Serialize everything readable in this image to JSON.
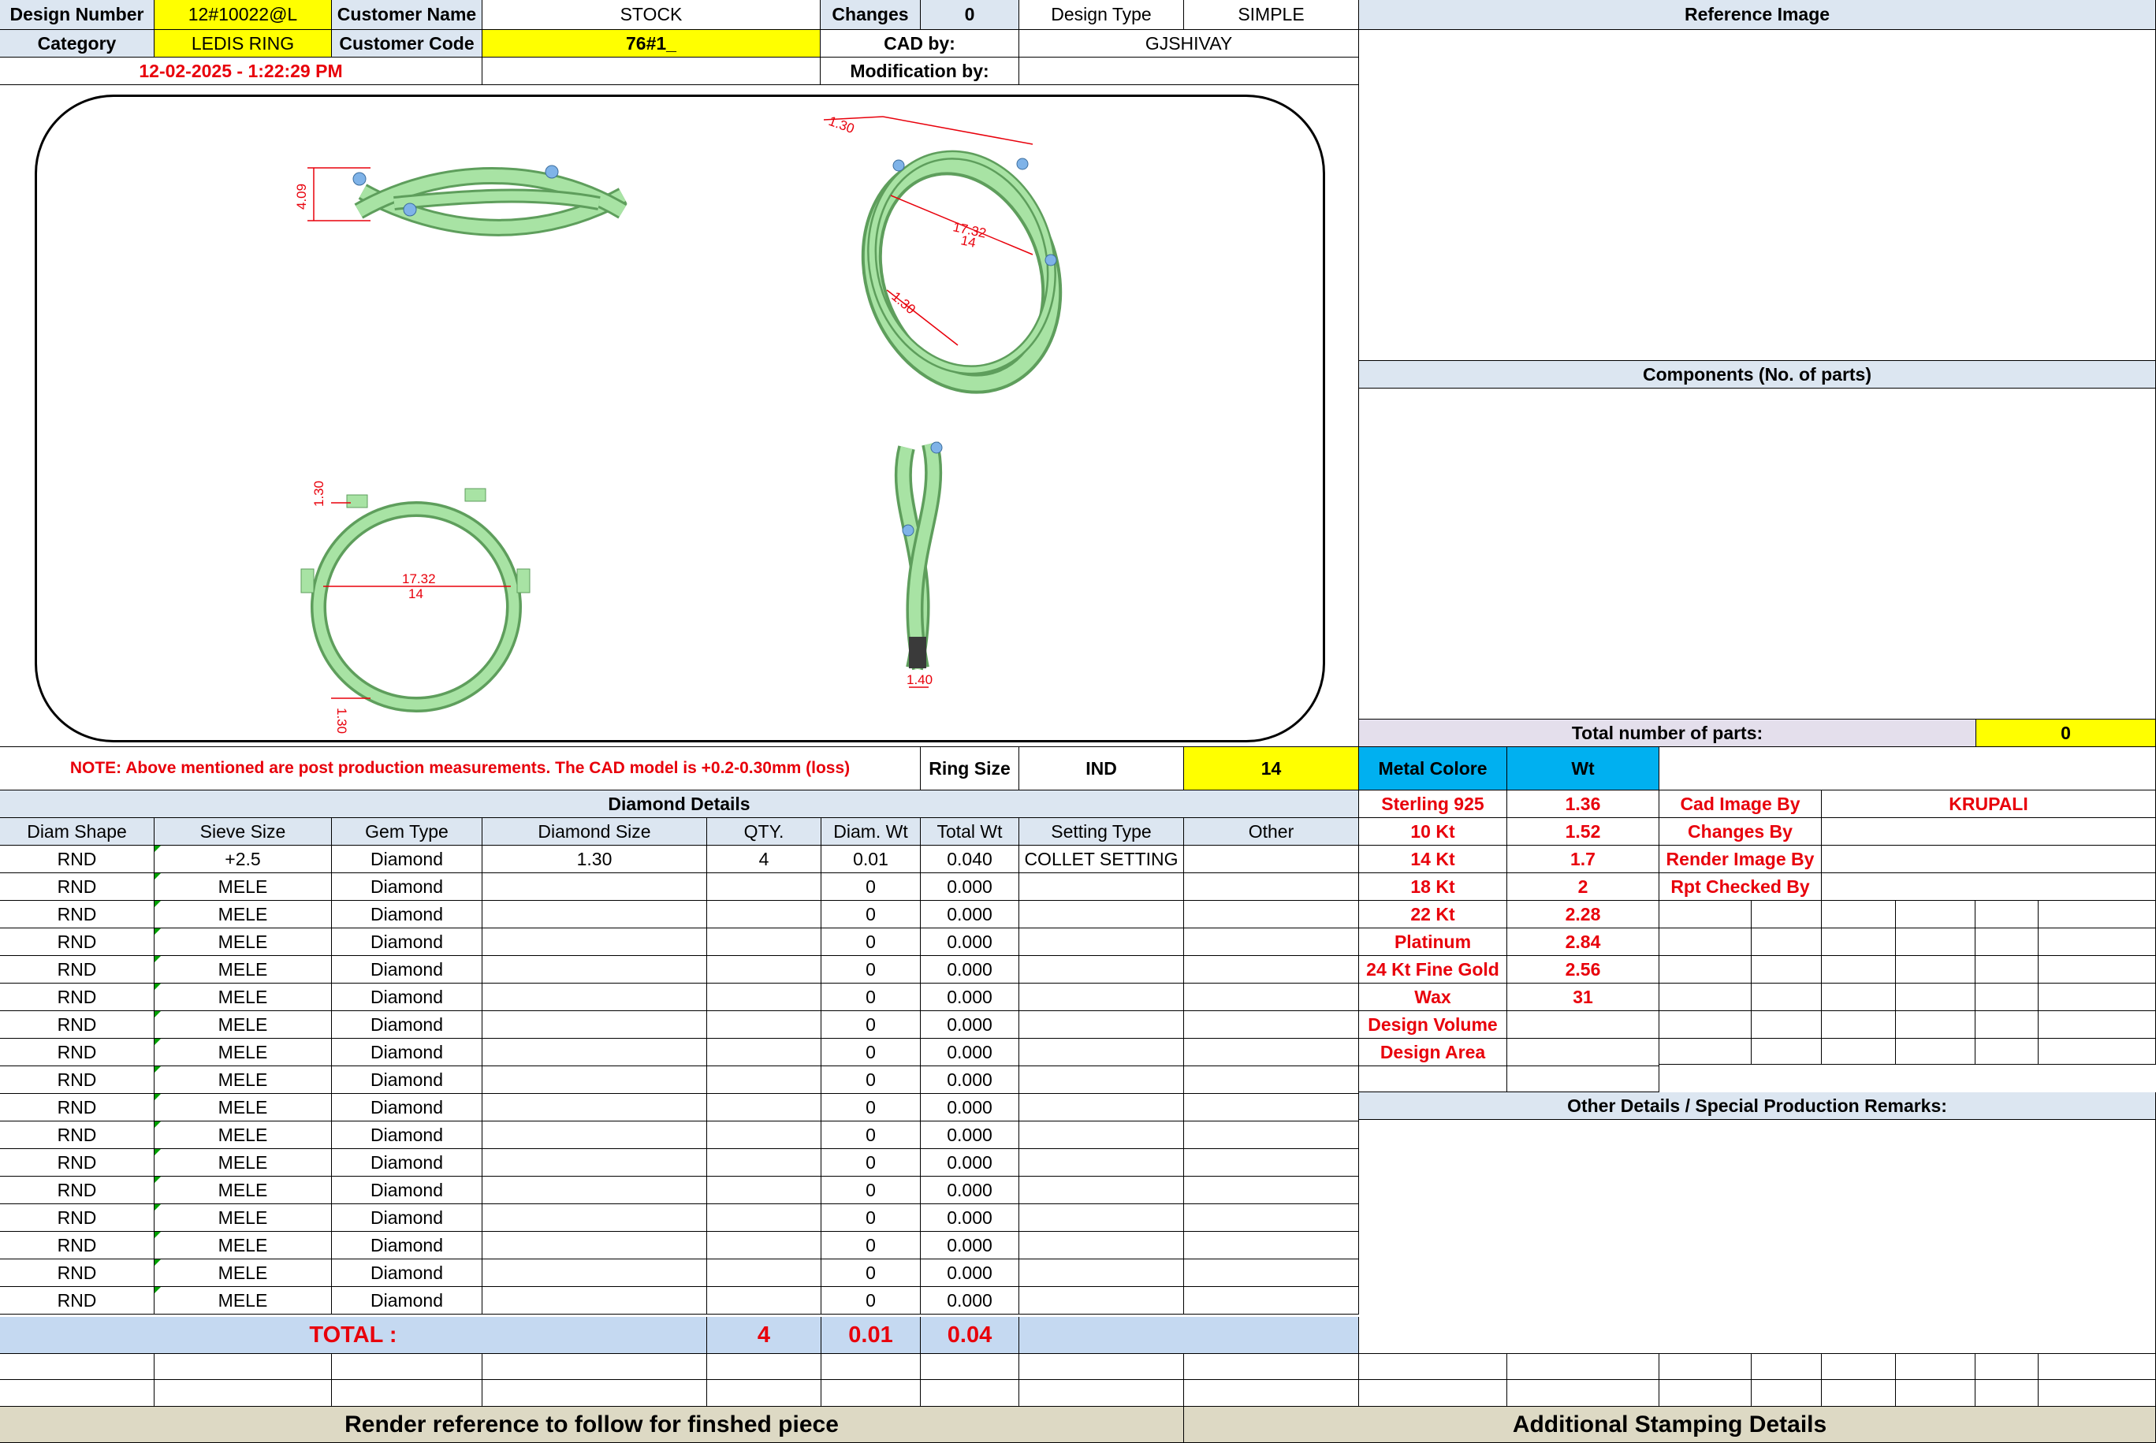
{
  "header": {
    "design_number_label": "Design Number",
    "design_number": "12#10022@L",
    "customer_name_label": "Customer Name",
    "customer_name": "STOCK",
    "changes_label": "Changes",
    "changes": "0",
    "design_type_label": "Design Type",
    "design_type": "SIMPLE",
    "reference_image_label": "Reference Image",
    "category_label": "Category",
    "category": "LEDIS RING",
    "customer_code_label": "Customer Code",
    "customer_code": "76#1_",
    "cad_by_label": "CAD by:",
    "cad_by": "GJSHIVAY",
    "timestamp": "12-02-2025 - 1:22:29 PM",
    "modification_by_label": "Modification by:"
  },
  "drawing": {
    "dims": {
      "side_height": "4.09",
      "top_width": "1.30",
      "persp_top": "1.30",
      "persp_inner": "17.32",
      "persp_size": "14",
      "persp_bottom": "1.30",
      "front_top": "1.30",
      "front_inner": "17.32",
      "front_size": "14",
      "front_bottom": "1.30",
      "profile_width": "1.40"
    },
    "colors": {
      "ring": "#a8e3a4",
      "ring_dark": "#5e9e5c",
      "stone": "#7fb3e8",
      "dim": "#e8000b"
    }
  },
  "components_label": "Components (No. of parts)",
  "total_parts_label": "Total number of parts:",
  "total_parts": "0",
  "note": "NOTE: Above mentioned are post production measurements. The CAD model is +0.2-0.30mm (loss)",
  "ring_size_label": "Ring Size",
  "ring_size_unit": "IND",
  "ring_size": "14",
  "diamond": {
    "title": "Diamond Details",
    "headers": [
      "Diam Shape",
      "Sieve Size",
      "Gem Type",
      "Diamond Size",
      "QTY.",
      "Diam. Wt",
      "Total Wt",
      "Setting Type",
      "Other"
    ],
    "rows": [
      [
        "RND",
        "+2.5",
        "Diamond",
        "1.30",
        "4",
        "0.01",
        "0.040",
        "COLLET SETTING",
        ""
      ],
      [
        "RND",
        "MELE",
        "Diamond",
        "",
        "",
        "0",
        "0.000",
        "",
        ""
      ],
      [
        "RND",
        "MELE",
        "Diamond",
        "",
        "",
        "0",
        "0.000",
        "",
        ""
      ],
      [
        "RND",
        "MELE",
        "Diamond",
        "",
        "",
        "0",
        "0.000",
        "",
        ""
      ],
      [
        "RND",
        "MELE",
        "Diamond",
        "",
        "",
        "0",
        "0.000",
        "",
        ""
      ],
      [
        "RND",
        "MELE",
        "Diamond",
        "",
        "",
        "0",
        "0.000",
        "",
        ""
      ],
      [
        "RND",
        "MELE",
        "Diamond",
        "",
        "",
        "0",
        "0.000",
        "",
        ""
      ],
      [
        "RND",
        "MELE",
        "Diamond",
        "",
        "",
        "0",
        "0.000",
        "",
        ""
      ],
      [
        "RND",
        "MELE",
        "Diamond",
        "",
        "",
        "0",
        "0.000",
        "",
        ""
      ],
      [
        "RND",
        "MELE",
        "Diamond",
        "",
        "",
        "0",
        "0.000",
        "",
        ""
      ],
      [
        "RND",
        "MELE",
        "Diamond",
        "",
        "",
        "0",
        "0.000",
        "",
        ""
      ],
      [
        "RND",
        "MELE",
        "Diamond",
        "",
        "",
        "0",
        "0.000",
        "",
        ""
      ],
      [
        "RND",
        "MELE",
        "Diamond",
        "",
        "",
        "0",
        "0.000",
        "",
        ""
      ],
      [
        "RND",
        "MELE",
        "Diamond",
        "",
        "",
        "0",
        "0.000",
        "",
        ""
      ],
      [
        "RND",
        "MELE",
        "Diamond",
        "",
        "",
        "0",
        "0.000",
        "",
        ""
      ],
      [
        "RND",
        "MELE",
        "Diamond",
        "",
        "",
        "0",
        "0.000",
        "",
        ""
      ],
      [
        "RND",
        "MELE",
        "Diamond",
        "",
        "",
        "0",
        "0.000",
        "",
        ""
      ]
    ],
    "total_label": "TOTAL :",
    "total_qty": "4",
    "total_diam_wt": "0.01",
    "total_wt": "0.04"
  },
  "metal": {
    "colore_label": "Metal Colore",
    "wt_label": "Wt",
    "rows": [
      [
        "Sterling 925",
        "1.36"
      ],
      [
        "10 Kt",
        "1.52"
      ],
      [
        "14 Kt",
        "1.7"
      ],
      [
        "18 Kt",
        "2"
      ],
      [
        "22 Kt",
        "2.28"
      ],
      [
        "Platinum",
        "2.84"
      ],
      [
        "24 Kt Fine Gold",
        "2.56"
      ],
      [
        "Wax",
        "31"
      ],
      [
        "Design Volume",
        ""
      ],
      [
        "Design Area",
        ""
      ]
    ]
  },
  "roles": {
    "rows": [
      [
        "Cad Image By",
        "KRUPALI"
      ],
      [
        "Changes By",
        ""
      ],
      [
        "Render Image By",
        ""
      ],
      [
        "Rpt Checked By",
        ""
      ]
    ]
  },
  "other_details_label": "Other Details / Special Production Remarks:",
  "render_reference_label": "Render reference to follow for finshed piece",
  "stamping_label": "Additional Stamping Details"
}
